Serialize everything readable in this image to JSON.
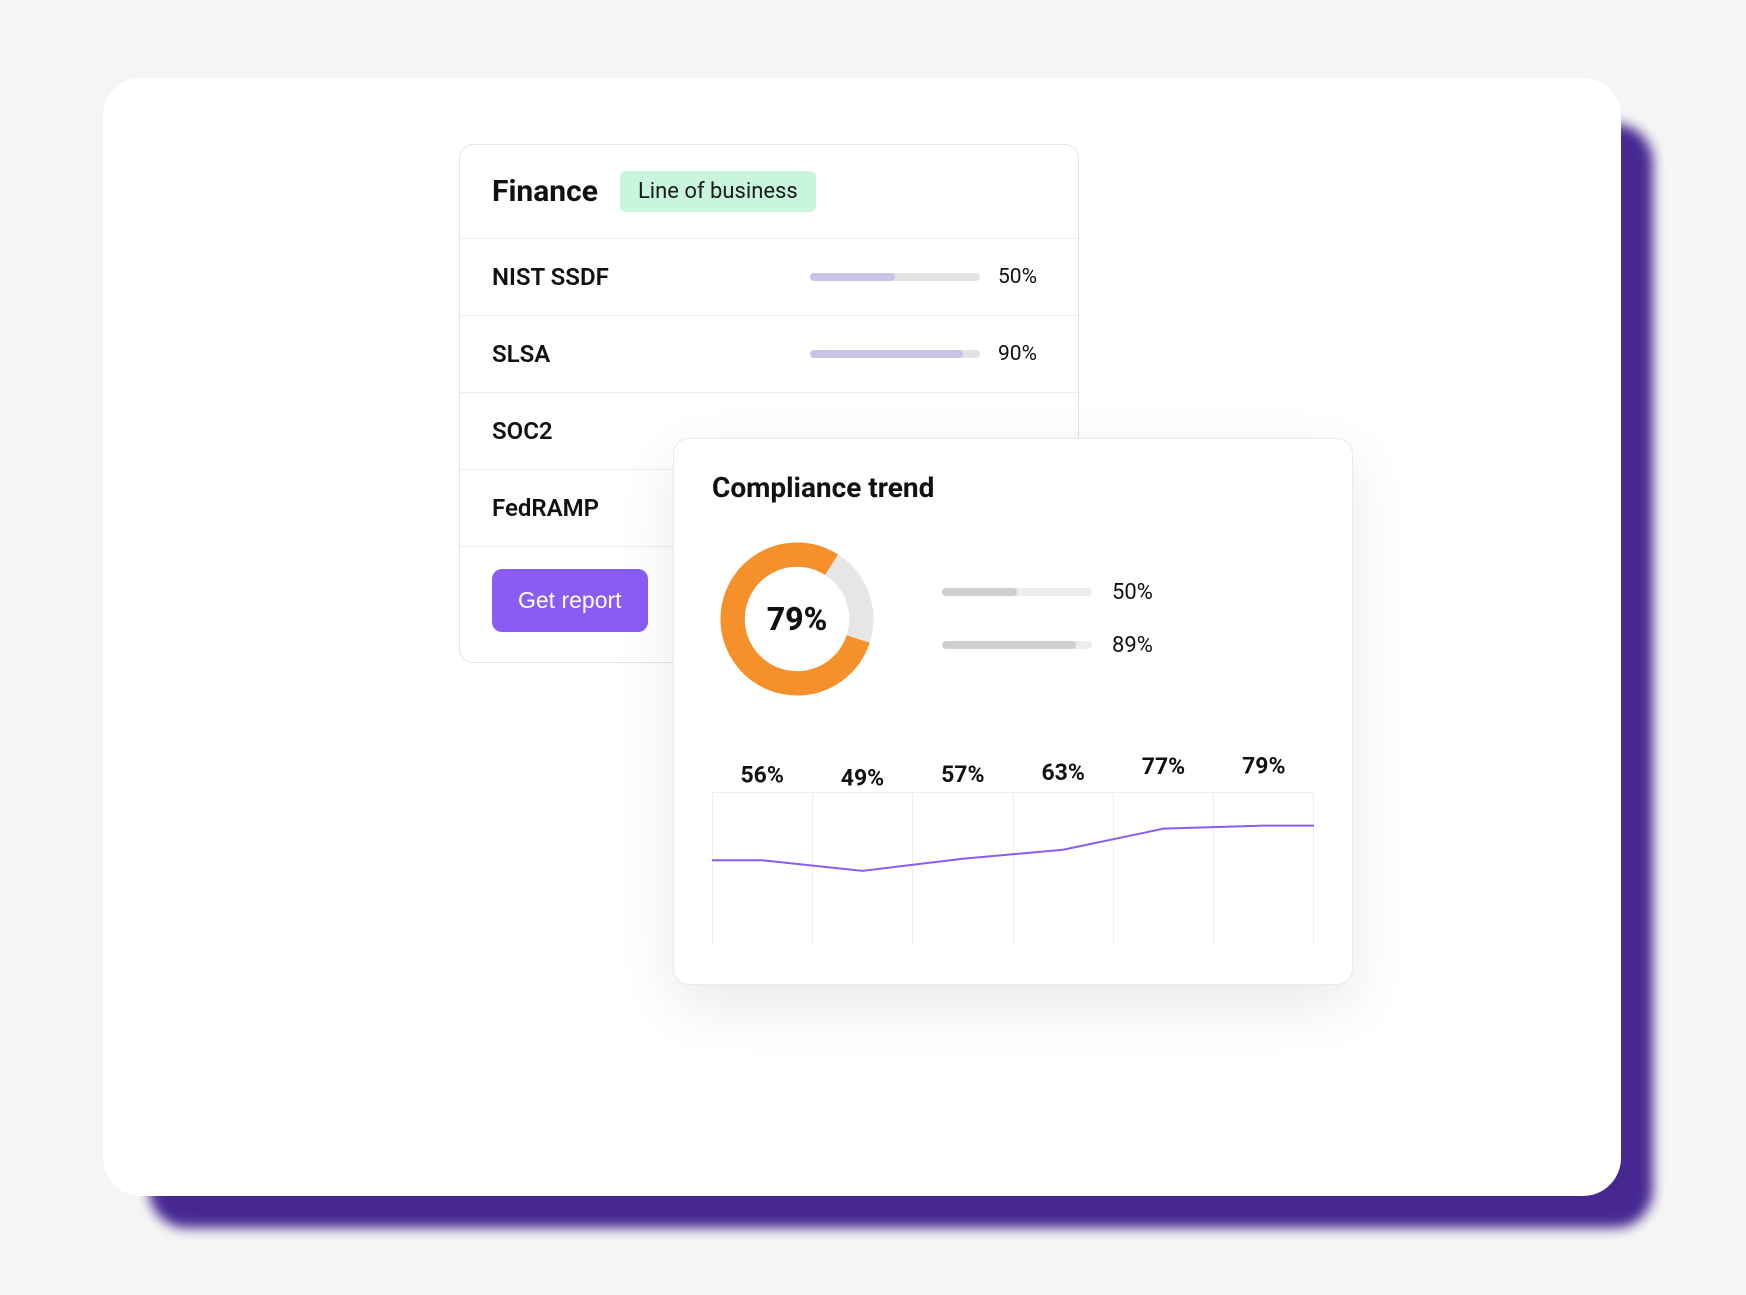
{
  "finance": {
    "title": "Finance",
    "badge": "Line of business",
    "frameworks": [
      {
        "name": "NIST SSDF",
        "pct": 50,
        "pct_label": "50%"
      },
      {
        "name": "SLSA",
        "pct": 90,
        "pct_label": "90%"
      },
      {
        "name": "SOC2",
        "pct": null,
        "pct_label": ""
      },
      {
        "name": "FedRAMP",
        "pct": null,
        "pct_label": ""
      }
    ],
    "button_label": "Get report"
  },
  "trend": {
    "title": "Compliance trend",
    "donut_pct": 79,
    "donut_label": "79%",
    "side_bars": [
      {
        "pct": 50,
        "pct_label": "50%"
      },
      {
        "pct": 89,
        "pct_label": "89%"
      }
    ]
  },
  "chart_data": {
    "type": "line",
    "title": "Compliance trend",
    "categories": [
      "",
      "",
      "",
      "",
      "",
      ""
    ],
    "values": [
      56,
      49,
      57,
      63,
      77,
      79
    ],
    "value_labels": [
      "56%",
      "49%",
      "57%",
      "63%",
      "77%",
      "79%"
    ],
    "ylim": [
      0,
      100
    ],
    "ylabel": "",
    "xlabel": ""
  },
  "colors": {
    "accent_purple": "#8a5cf5",
    "donut_orange": "#f6902a",
    "donut_track": "#e6e6e6",
    "line_purple": "#8a5cf5",
    "badge_bg": "#c9f5dd",
    "shadow_purple": "#3e1e8c"
  }
}
